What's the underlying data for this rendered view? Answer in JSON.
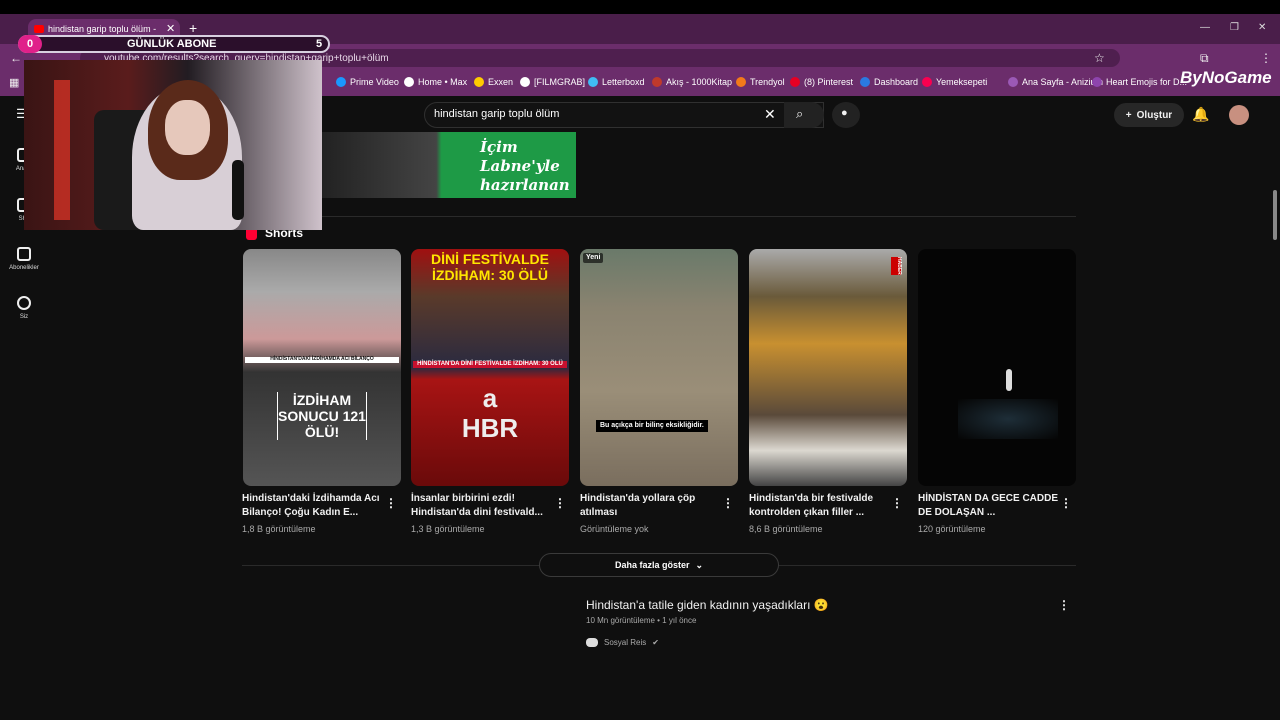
{
  "browser": {
    "tab_title": "hindistan garip toplu ölüm - Yo",
    "url": "youtube.com/results?search_query=hindistan+garip+toplu+ölüm",
    "bookmarks": [
      {
        "label": "Prime Video",
        "color": "#1a98ff"
      },
      {
        "label": "Home • Max",
        "color": "#ffffff"
      },
      {
        "label": "Exxen",
        "color": "#ffcc00"
      },
      {
        "label": "[FILMGRAB]",
        "color": "#ffffff"
      },
      {
        "label": "Letterboxd",
        "color": "#40bcf4"
      },
      {
        "label": "Akış - 1000Kitap",
        "color": "#c0392b"
      },
      {
        "label": "Trendyol",
        "color": "#f27a1a"
      },
      {
        "label": "(8) Pinterest",
        "color": "#e60023"
      },
      {
        "label": "Dashboard",
        "color": "#2a7ae2"
      },
      {
        "label": "Yemeksepeti",
        "color": "#fa0050"
      },
      {
        "label": "Ana Sayfa - Anizium",
        "color": "#9b59b6"
      },
      {
        "label": "Heart Emojis for D...",
        "color": "#8e44ad"
      }
    ],
    "brand": "ByNoGame"
  },
  "overlay": {
    "count_left": "0",
    "label": "GÜNLÜK ABONE",
    "count_right": "5"
  },
  "youtube": {
    "search_value": "hindistan garip toplu ölüm",
    "create_label": "Oluştur",
    "sidebar": [
      {
        "label": "Ana S"
      },
      {
        "label": "Sho"
      },
      {
        "label": "Abonelikler"
      },
      {
        "label": "Siz"
      }
    ],
    "ad_text": [
      "İçim",
      "Labne'yle",
      "hazırlanan"
    ],
    "shorts_heading": "Shorts",
    "shorts": [
      {
        "title": "Hindistan'daki İzdihamda Acı Bilanço! Çoğu Kadın E...",
        "views": "1,8 B görüntüleme",
        "overlay": "İZDİHAM SONUCU 121 ÖLÜ!",
        "caption": "HİNDİSTAN'DAKİ İZDİHAMDA ACI BİLANÇO"
      },
      {
        "title": "İnsanlar birbirini ezdi! Hindistan'da dini festivald...",
        "views": "1,3 B görüntüleme",
        "overlay": "DİNİ FESTİVALDE İZDİHAM: 30 ÖLÜ",
        "caption": "HİNDİSTAN'DA DİNİ FESTİVALDE İZDİHAM: 30 ÖLÜ",
        "logo": "a HBR"
      },
      {
        "title": "Hindistan'da yollara çöp atılması",
        "views": "Görüntüleme yok",
        "badge": "Yeni",
        "caption": "Bu açıkça bir bilinç eksikliğidir."
      },
      {
        "title": "Hindistan'da bir festivalde kontrolden çıkan filler ...",
        "views": "8,6 B görüntüleme",
        "tag": "HABER"
      },
      {
        "title": "HİNDİSTAN DA GECE CADDE DE DOLAŞAN ...",
        "views": "120 görüntüleme"
      }
    ],
    "show_more": "Daha fazla göster",
    "next_video": {
      "title": "Hindistan'a tatile giden kadının yaşadıkları 😮",
      "meta": "10 Mn görüntüleme • 1 yıl önce",
      "channel": "Sosyal Reis"
    }
  }
}
